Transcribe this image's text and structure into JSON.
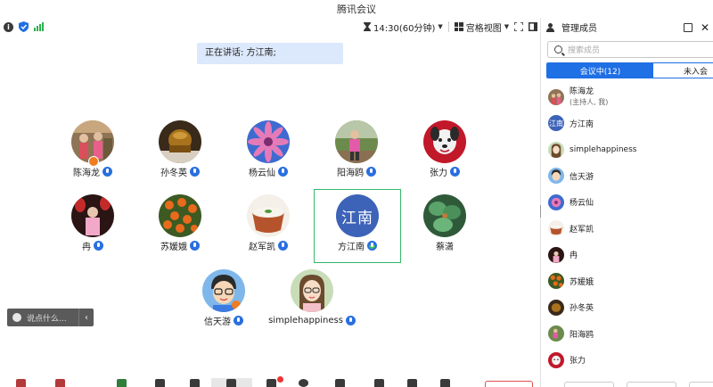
{
  "window": {
    "title": "腾讯会议"
  },
  "toolbar": {
    "duration": "14:30(60分钟)",
    "view_mode": "宫格视图"
  },
  "speaking_banner": "正在讲话: 方江南;",
  "participants": [
    {
      "name": "陈海龙",
      "avatar": "photo-people"
    },
    {
      "name": "孙冬英",
      "avatar": "photo-bronze"
    },
    {
      "name": "杨云仙",
      "avatar": "photo-pink-flower"
    },
    {
      "name": "阳海鸥",
      "avatar": "photo-child"
    },
    {
      "name": "张力",
      "avatar": "photo-cartoon-dog"
    },
    {
      "name": "冉",
      "avatar": "photo-lantern"
    },
    {
      "name": "苏媛娥",
      "avatar": "photo-orange-flowers"
    },
    {
      "name": "赵军凯",
      "avatar": "photo-bowl"
    },
    {
      "name": "方江南",
      "avatar": "text-avatar",
      "avatar_text": "江南",
      "speaking": true
    },
    {
      "name": "蔡潇",
      "avatar": "photo-green-leaves"
    },
    {
      "name": "信天游",
      "avatar": "cartoon-boy"
    },
    {
      "name": "simplehappiness",
      "avatar": "cartoon-girl"
    }
  ],
  "chat": {
    "placeholder": "说点什么..."
  },
  "panel": {
    "title": "管理成员",
    "search_placeholder": "搜索成员",
    "tab_in_meeting": "会议中(12)",
    "tab_not_joined": "未入会",
    "members": [
      {
        "name": "陈海龙",
        "sub": "(主持人, 我)"
      },
      {
        "name": "方江南",
        "avatar_text": "江南"
      },
      {
        "name": "simplehappiness"
      },
      {
        "name": "信天游"
      },
      {
        "name": "杨云仙"
      },
      {
        "name": "赵军凯"
      },
      {
        "name": "冉"
      },
      {
        "name": "苏媛娥"
      },
      {
        "name": "孙冬英"
      },
      {
        "name": "阳海鸥"
      },
      {
        "name": "张力"
      }
    ]
  },
  "colors": {
    "accent": "#1f6fe5",
    "speaking_border": "#35b86a",
    "banner_bg": "#dce8fb",
    "text_avatar": "#3d63b8"
  }
}
